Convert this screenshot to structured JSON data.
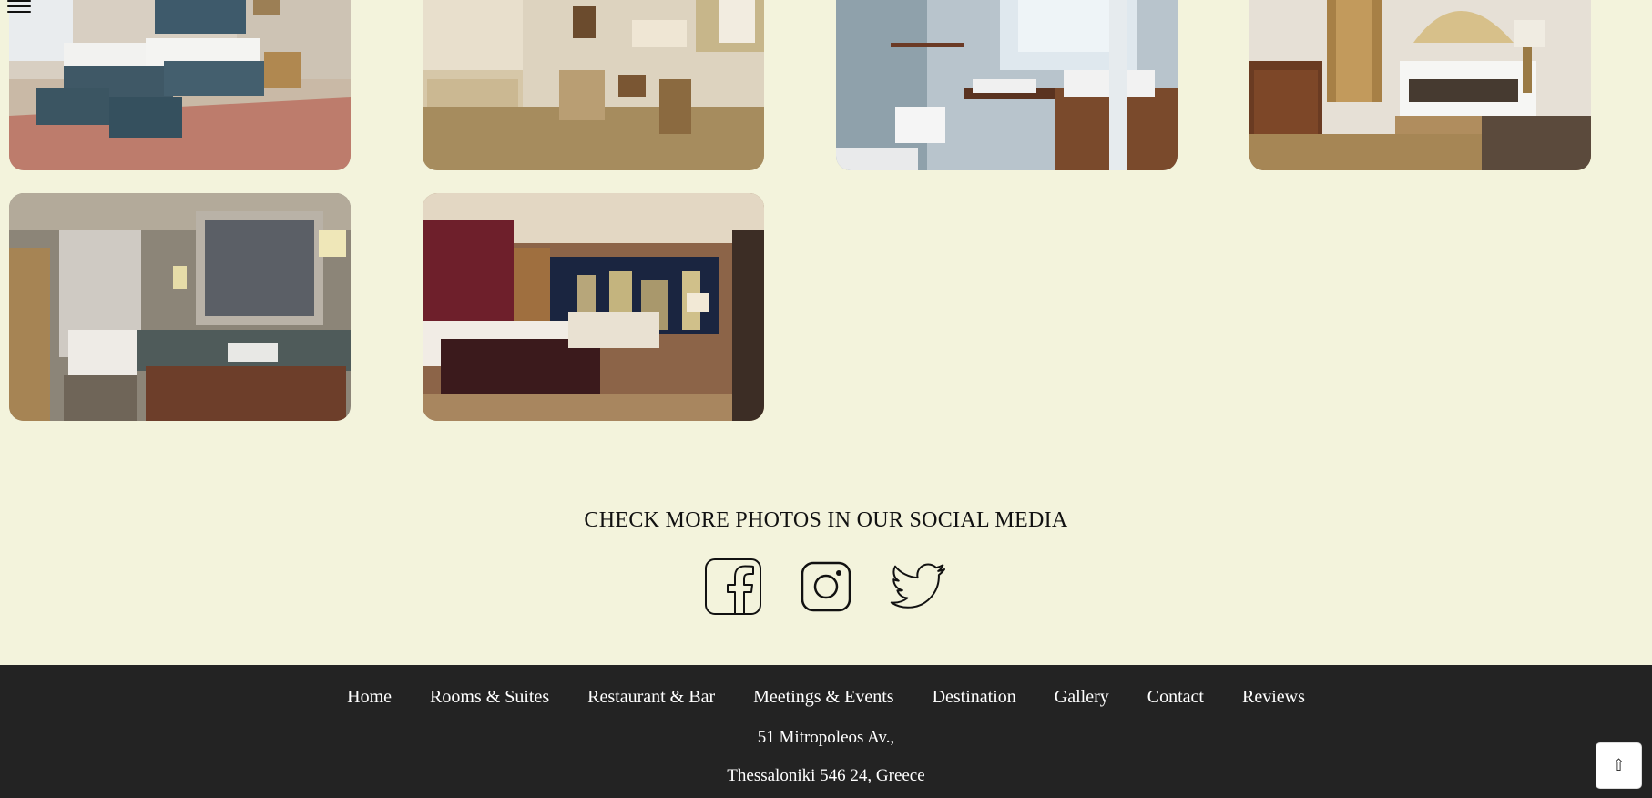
{
  "gallery": {
    "photos": [
      {
        "name": "hotel-room-twin-beds-photo"
      },
      {
        "name": "hotel-suite-vanity-lounge-photo"
      },
      {
        "name": "hotel-bathroom-glass-photo"
      },
      {
        "name": "hotel-baroque-bedroom-photo"
      },
      {
        "name": "hotel-marble-bathroom-photo"
      },
      {
        "name": "hotel-city-view-suite-photo"
      }
    ]
  },
  "social": {
    "title": "CHECK MORE PHOTOS IN OUR SOCIAL MEDIA",
    "icons": [
      "facebook-icon",
      "instagram-icon",
      "twitter-icon"
    ]
  },
  "footer": {
    "nav": [
      "Home",
      "Rooms & Suites",
      "Restaurant & Bar",
      "Meetings & Events",
      "Destination",
      "Gallery",
      "Contact",
      "Reviews"
    ],
    "address_line1": "51 Mitropoleos Av.,",
    "address_line2": "Thessaloniki 546 24, Greece"
  },
  "scroll_top": {
    "label": "⇧"
  },
  "colors": {
    "page_bg": "#f3f3dc",
    "footer_bg": "#232323",
    "text": "#111111"
  }
}
